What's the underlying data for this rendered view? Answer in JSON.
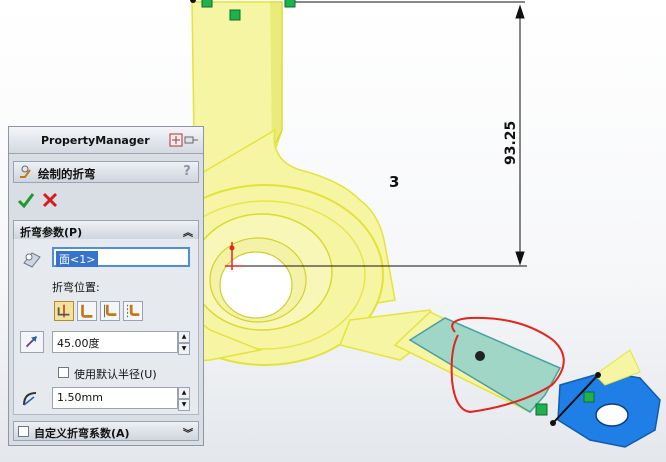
{
  "drawing": {
    "dimension_value": "93.25",
    "annotation_number": "3"
  },
  "property_manager": {
    "title": "PropertyManager",
    "feature_name": "绘制的折弯",
    "help": "?",
    "bend_params": {
      "header": "折弯参数(P)",
      "face_selection": "面<1>",
      "bend_position_label": "折弯位置:",
      "angle_value": "45.00度",
      "use_default_radius_label": "使用默认半径(U)",
      "radius_value": "1.50mm"
    },
    "custom_bend": {
      "header": "自定义折弯系数(A)"
    }
  },
  "colors": {
    "part_yellow": "#f5f4a0",
    "part_edge": "#e6e63a",
    "sheet_teal": "#9fd6c6",
    "tab_blue": "#1f7fe6",
    "annotation_red": "#e2261e",
    "sketch_green": "#1fb050"
  }
}
